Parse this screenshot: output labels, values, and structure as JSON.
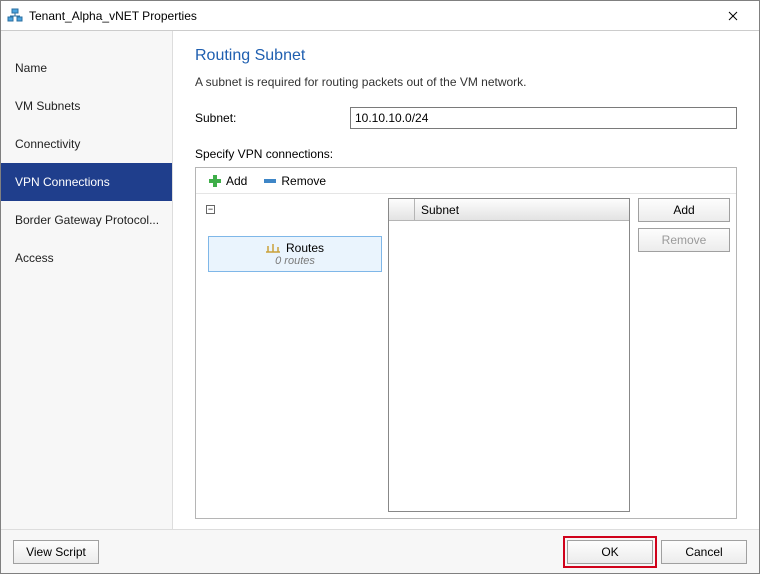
{
  "window": {
    "title": "Tenant_Alpha_vNET Properties"
  },
  "sidebar": {
    "items": [
      {
        "label": "Name"
      },
      {
        "label": "VM Subnets"
      },
      {
        "label": "Connectivity"
      },
      {
        "label": "VPN Connections"
      },
      {
        "label": "Border Gateway Protocol..."
      },
      {
        "label": "Access"
      }
    ]
  },
  "main": {
    "title": "Routing Subnet",
    "description": "A subnet is required for routing packets out of the VM network.",
    "subnet_label": "Subnet:",
    "subnet_value": "10.10.10.0/24",
    "vpn_label": "Specify VPN connections:"
  },
  "toolbar": {
    "add_label": "Add",
    "remove_label": "Remove"
  },
  "tree": {
    "collapse_glyph": "−",
    "routes_label": "Routes",
    "routes_sub": "0 routes"
  },
  "subnet_table": {
    "header": "Subnet"
  },
  "buttons": {
    "add": "Add",
    "remove": "Remove"
  },
  "footer": {
    "view_script": "View Script",
    "ok": "OK",
    "cancel": "Cancel"
  }
}
